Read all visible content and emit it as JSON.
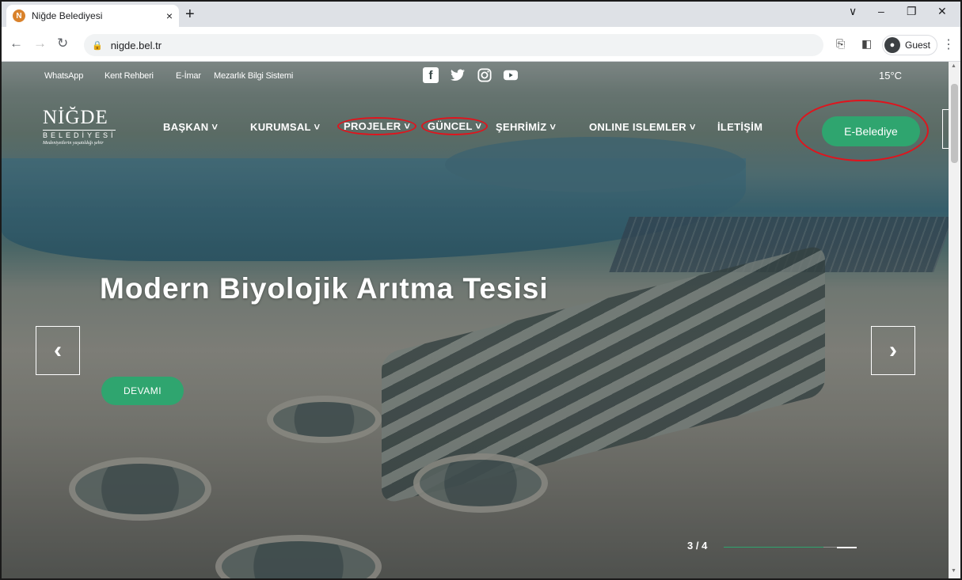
{
  "browser": {
    "tab_title": "Niğde Belediyesi",
    "favicon_letter": "N",
    "tab_close": "×",
    "new_tab": "+",
    "window_controls": [
      "∨",
      "–",
      "❐",
      "✕"
    ],
    "url": "nigde.bel.tr",
    "profile_label": "Guest"
  },
  "site": {
    "top_links": [
      "WhatsApp",
      "Kent Rehberi",
      "E-İmar",
      "Mezarlık Bilgi Sistemi"
    ],
    "social_icons": [
      "facebook-icon",
      "twitter-icon",
      "instagram-icon",
      "youtube-icon"
    ],
    "temperature": "15°C",
    "logo": {
      "main": "NİĞDE",
      "sub": "BELEDİYESİ",
      "tagline": "Medeniyetlerin yaşatıldığı şehir"
    },
    "menu": [
      "BAŞKAN ˅",
      "KURUMSAL ˅",
      "PROJELER ˅",
      "GÜNCEL ˅",
      "ŞEHRİMİZ ˅",
      "ONLINE ISLEMLER ˅",
      "İLETİŞİM"
    ],
    "circled_menu_items": [
      "PROJELER",
      "GÜNCEL"
    ],
    "ebelediye_button": "E-Belediye",
    "hero_title": "Modern Biyolojik Arıtma Tesisi",
    "prev_arrow": "‹",
    "next_arrow": "›",
    "read_more_button": "DEVAMI",
    "slide_counter": "3 / 4",
    "slide_progress": 0.75,
    "accent_color": "#2fa56f",
    "annotation_color": "#e0141d"
  }
}
